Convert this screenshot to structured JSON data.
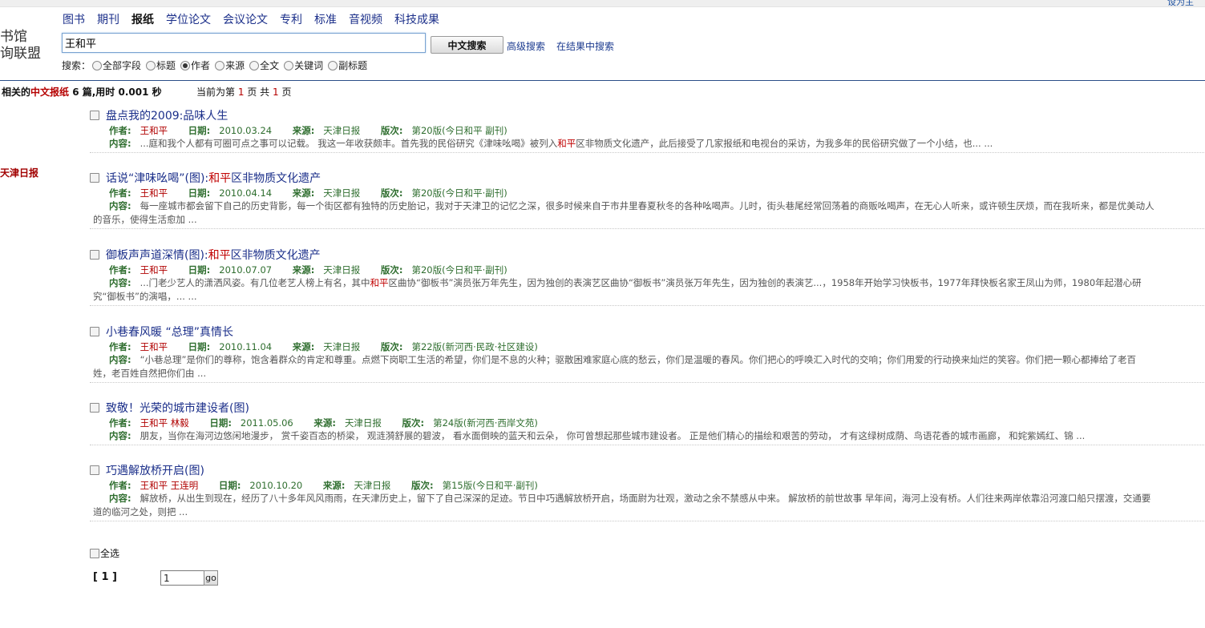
{
  "topbar": {
    "right_text": "设为主"
  },
  "logo": {
    "line1": "书馆",
    "line2": "询联盟"
  },
  "nav": [
    "图书",
    "期刊",
    "报纸",
    "学位论文",
    "会议论文",
    "专利",
    "标准",
    "音视频",
    "科技成果"
  ],
  "nav_active_index": 2,
  "search": {
    "query": "王和平",
    "button_label": "中文搜索",
    "advanced_link": "高级搜索",
    "within_link": "在结果中搜索",
    "field_label": "搜索：",
    "fields": [
      "全部字段",
      "标题",
      "作者",
      "来源",
      "全文",
      "关键词",
      "副标题"
    ],
    "selected_field": "作者"
  },
  "stats": {
    "prefix": "相关的",
    "type": "中文报纸",
    "count_text": "6 篇,用时 0.001 秒",
    "page_prefix": "当前为第",
    "current_page": "1",
    "page_mid": "页 共",
    "total_pages": "1",
    "page_suffix": "页"
  },
  "sidebar": {
    "facet": "天津日报"
  },
  "labels": {
    "author": "作者:",
    "date": "日期:",
    "source": "来源:",
    "edition": "版次:",
    "content": "内容:"
  },
  "results": [
    {
      "title": "盘点我的2009:品味人生",
      "authors": "王和平",
      "date": "2010.03.24",
      "source": "天津日报",
      "edition": "第20版(今日和平 副刊)",
      "content": "...庭和我个人都有可圈可点之事可以记载。 我这一年收获颇丰。首先我的民俗研究《津味吆喝》被列入和平区非物质文化遗产，此后接受了几家报纸和电视台的采访，为我多年的民俗研究做了一个小结，也... ...",
      "content2": ""
    },
    {
      "title": "话说“津味吆喝”(图):和平区非物质文化遗产",
      "authors": "王和平",
      "date": "2010.04.14",
      "source": "天津日报",
      "edition": "第20版(今日和平·副刊)",
      "content": "每一座城市都会留下自己的历史背影，每一个街区都有独特的历史胎记，我对于天津卫的记忆之深，很多时候来自于市井里春夏秋冬的各种吆喝声。儿时，街头巷尾经常回荡着的商贩吆喝声，在无心人听来，或许顿生厌烦，而在我听来，都是优美动人",
      "content2": "的音乐，使得生活愈加 ..."
    },
    {
      "title": "御板声声道深情(图):和平区非物质文化遗产",
      "authors": "王和平",
      "date": "2010.07.07",
      "source": "天津日报",
      "edition": "第20版(今日和平·副刊)",
      "content": "...门老少艺人的潇洒风姿。有几位老艺人榜上有名，其中和平区曲协“御板书”演员张万年先生，因为独创的表演艺区曲协“御板书”演员张万年先生，因为独创的表演艺...，1958年开始学习快板书，1977年拜快板名家王凤山为师，1980年起潜心研",
      "content2": "究“御板书”的演唱，... ..."
    },
    {
      "title": "小巷春风暖 “总理”真情长",
      "authors": "王和平",
      "date": "2010.11.04",
      "source": "天津日报",
      "edition": "第22版(新河西·民政·社区建设)",
      "content": "“小巷总理”是你们的尊称，饱含着群众的肯定和尊重。点燃下岗职工生活的希望，你们是不息的火种；驱散困难家庭心底的愁云，你们是温暖的春风。你们把心的呼唤汇入时代的交响；你们用爱的行动换来灿烂的笑容。你们把一颗心都捧给了老百",
      "content2": "姓，老百姓自然把你们由 ..."
    },
    {
      "title": "致敬！光荣的城市建设者(图)",
      "authors": "王和平 林毅",
      "date": "2011.05.06",
      "source": "天津日报",
      "edition": "第24版(新河西·西岸文苑)",
      "content": "朋友，当你在海河边悠闲地漫步， 赏千姿百态的桥梁， 观涟漪舒展的碧波， 看水面倒映的蓝天和云朵， 你可曾想起那些城市建设者。 正是他们精心的描绘和艰苦的劳动， 才有这绿树成荫、鸟语花香的城市画廊， 和姹紫嫣红、锦 ...",
      "content2": ""
    },
    {
      "title": "巧遇解放桥开启(图)",
      "authors": "王和平 王连明",
      "date": "2010.10.20",
      "source": "天津日报",
      "edition": "第15版(今日和平·副刊)",
      "content": "解放桥，从出生到现在，经历了八十多年风风雨雨，在天津历史上，留下了自己深深的足迹。节日中巧遇解放桥开启，场面尉为壮观，激动之余不禁感从中来。 解放桥的前世故事 早年间，海河上没有桥。人们往来两岸依靠沿河渡口船只摆渡，交通要",
      "content2": "道的临河之处，则把 ..."
    }
  ],
  "footer": {
    "select_all": "全选",
    "pager": "[ 1 ]",
    "page_input": "1",
    "go": "go"
  }
}
